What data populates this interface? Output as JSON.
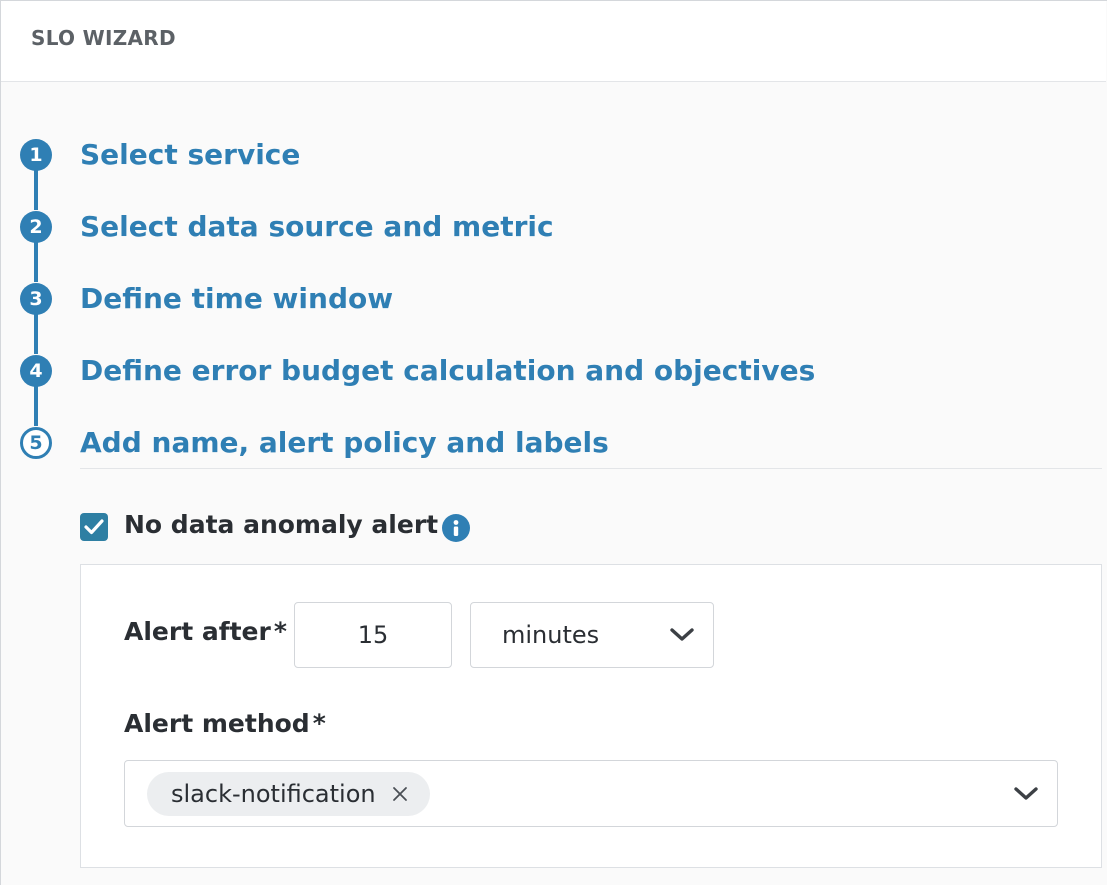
{
  "header": {
    "title": "SLO WIZARD"
  },
  "steps": [
    {
      "number": "1",
      "label": "Select service"
    },
    {
      "number": "2",
      "label": "Select data source and metric"
    },
    {
      "number": "3",
      "label": "Define time window"
    },
    {
      "number": "4",
      "label": "Define error budget calculation and objectives"
    },
    {
      "number": "5",
      "label": "Add name, alert policy and labels"
    }
  ],
  "no_data_alert": {
    "label": "No data anomaly alert",
    "checked": true,
    "info_icon": "info-icon"
  },
  "alert_after": {
    "label": "Alert after",
    "required_mark": "*",
    "value": "15",
    "unit": "minutes"
  },
  "alert_method": {
    "label": "Alert method",
    "required_mark": "*",
    "selected": [
      "slack-notification"
    ]
  },
  "colors": {
    "accent": "#2f7fb4",
    "checkbox": "#2e7fa3",
    "text": "#2a2e33"
  }
}
